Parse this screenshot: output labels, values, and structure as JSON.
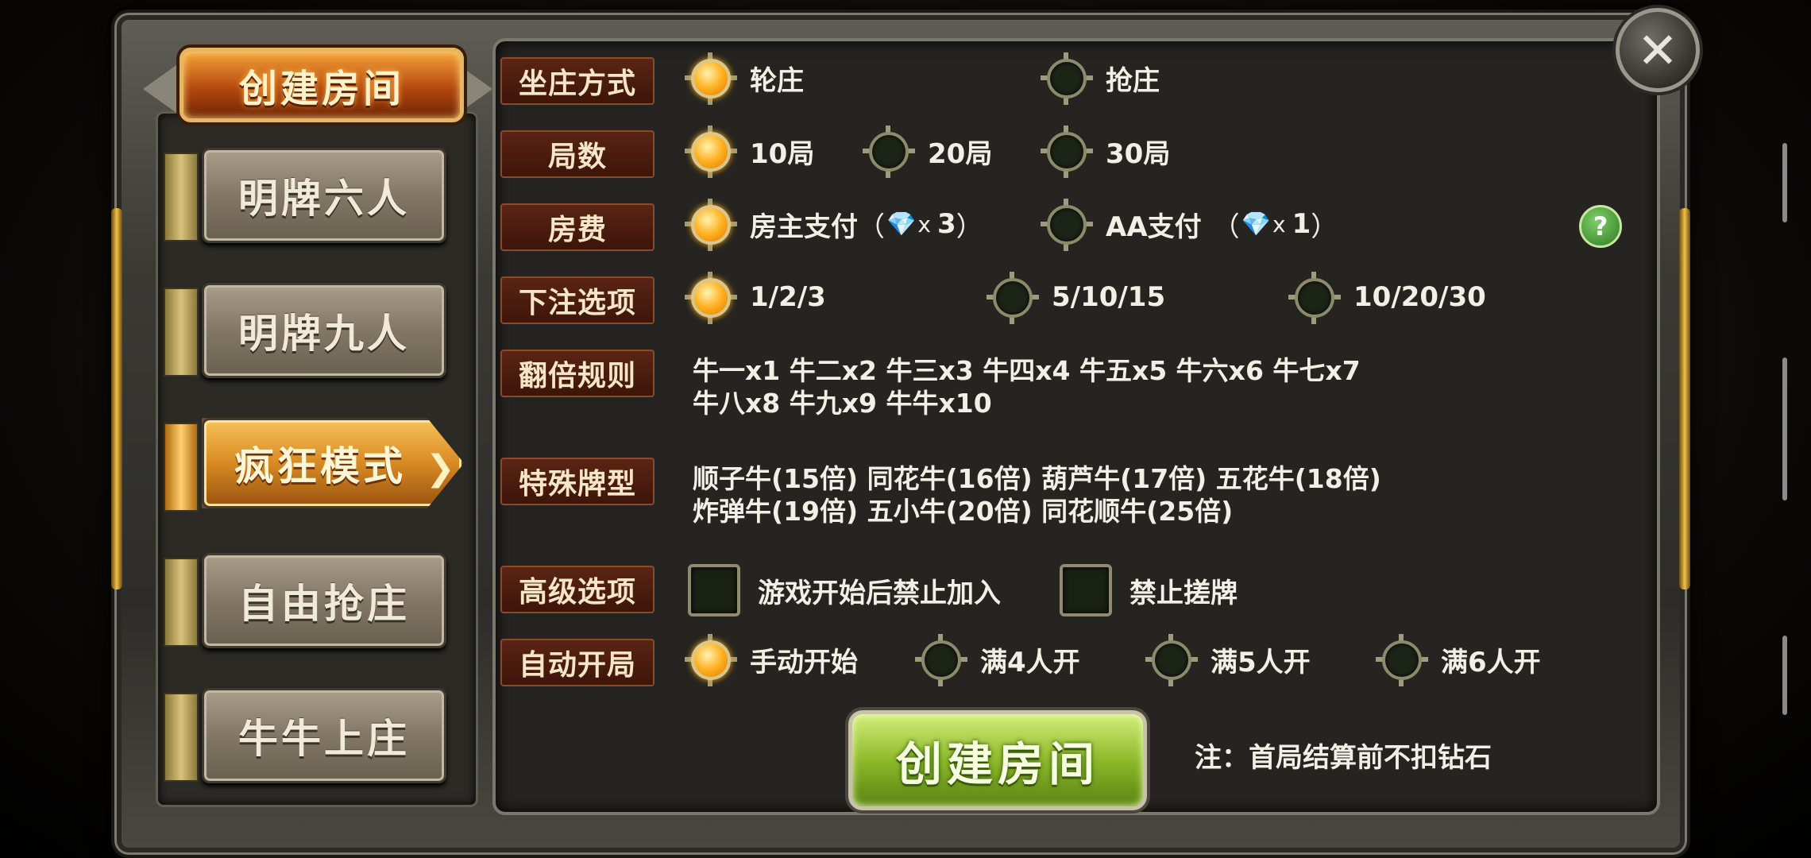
{
  "title": "创建房间",
  "close_label": "✕",
  "tabs": [
    {
      "label": "明牌六人",
      "active": false
    },
    {
      "label": "明牌九人",
      "active": false
    },
    {
      "label": "疯狂模式",
      "active": true
    },
    {
      "label": "自由抢庄",
      "active": false
    },
    {
      "label": "牛牛上庄",
      "active": false
    }
  ],
  "rows": {
    "banker_mode": {
      "label": "坐庄方式",
      "options": [
        {
          "label": "轮庄",
          "selected": true
        },
        {
          "label": "抢庄",
          "selected": false
        }
      ]
    },
    "rounds": {
      "label": "局数",
      "options": [
        {
          "label": "10局",
          "selected": true
        },
        {
          "label": "20局",
          "selected": false
        },
        {
          "label": "30局",
          "selected": false
        }
      ]
    },
    "fee": {
      "label": "房费",
      "options": [
        {
          "label": "房主支付",
          "selected": true,
          "open_paren": "（",
          "gem": "💎",
          "mult": "x",
          "count": "3",
          "close_paren": "）"
        },
        {
          "label": "AA支付",
          "selected": false,
          "open_paren": "（",
          "gem": "💎",
          "mult": "x",
          "count": "1",
          "close_paren": "）"
        }
      ]
    },
    "bet": {
      "label": "下注选项",
      "options": [
        {
          "label": "1/2/3",
          "selected": true
        },
        {
          "label": "5/10/15",
          "selected": false
        },
        {
          "label": "10/20/30",
          "selected": false
        }
      ]
    },
    "double_rules": {
      "label": "翻倍规则",
      "line1": "牛一x1  牛二x2  牛三x3  牛四x4  牛五x5  牛六x6  牛七x7",
      "line2": "牛八x8  牛九x9  牛牛x10"
    },
    "special": {
      "label": "特殊牌型",
      "line1": "顺子牛(15倍)  同花牛(16倍)  葫芦牛(17倍)  五花牛(18倍)",
      "line2": "炸弹牛(19倍)  五小牛(20倍)  同花顺牛(25倍)"
    },
    "advanced": {
      "label": "高级选项",
      "options": [
        {
          "label": "游戏开始后禁止加入",
          "checked": false
        },
        {
          "label": "禁止搓牌",
          "checked": false
        }
      ]
    },
    "auto_start": {
      "label": "自动开局",
      "options": [
        {
          "label": "手动开始",
          "selected": true
        },
        {
          "label": "满4人开",
          "selected": false
        },
        {
          "label": "满5人开",
          "selected": false
        },
        {
          "label": "满6人开",
          "selected": false
        }
      ]
    }
  },
  "help_label": "?",
  "create_button": "创建房间",
  "note": "注：首局结算前不扣钻石"
}
